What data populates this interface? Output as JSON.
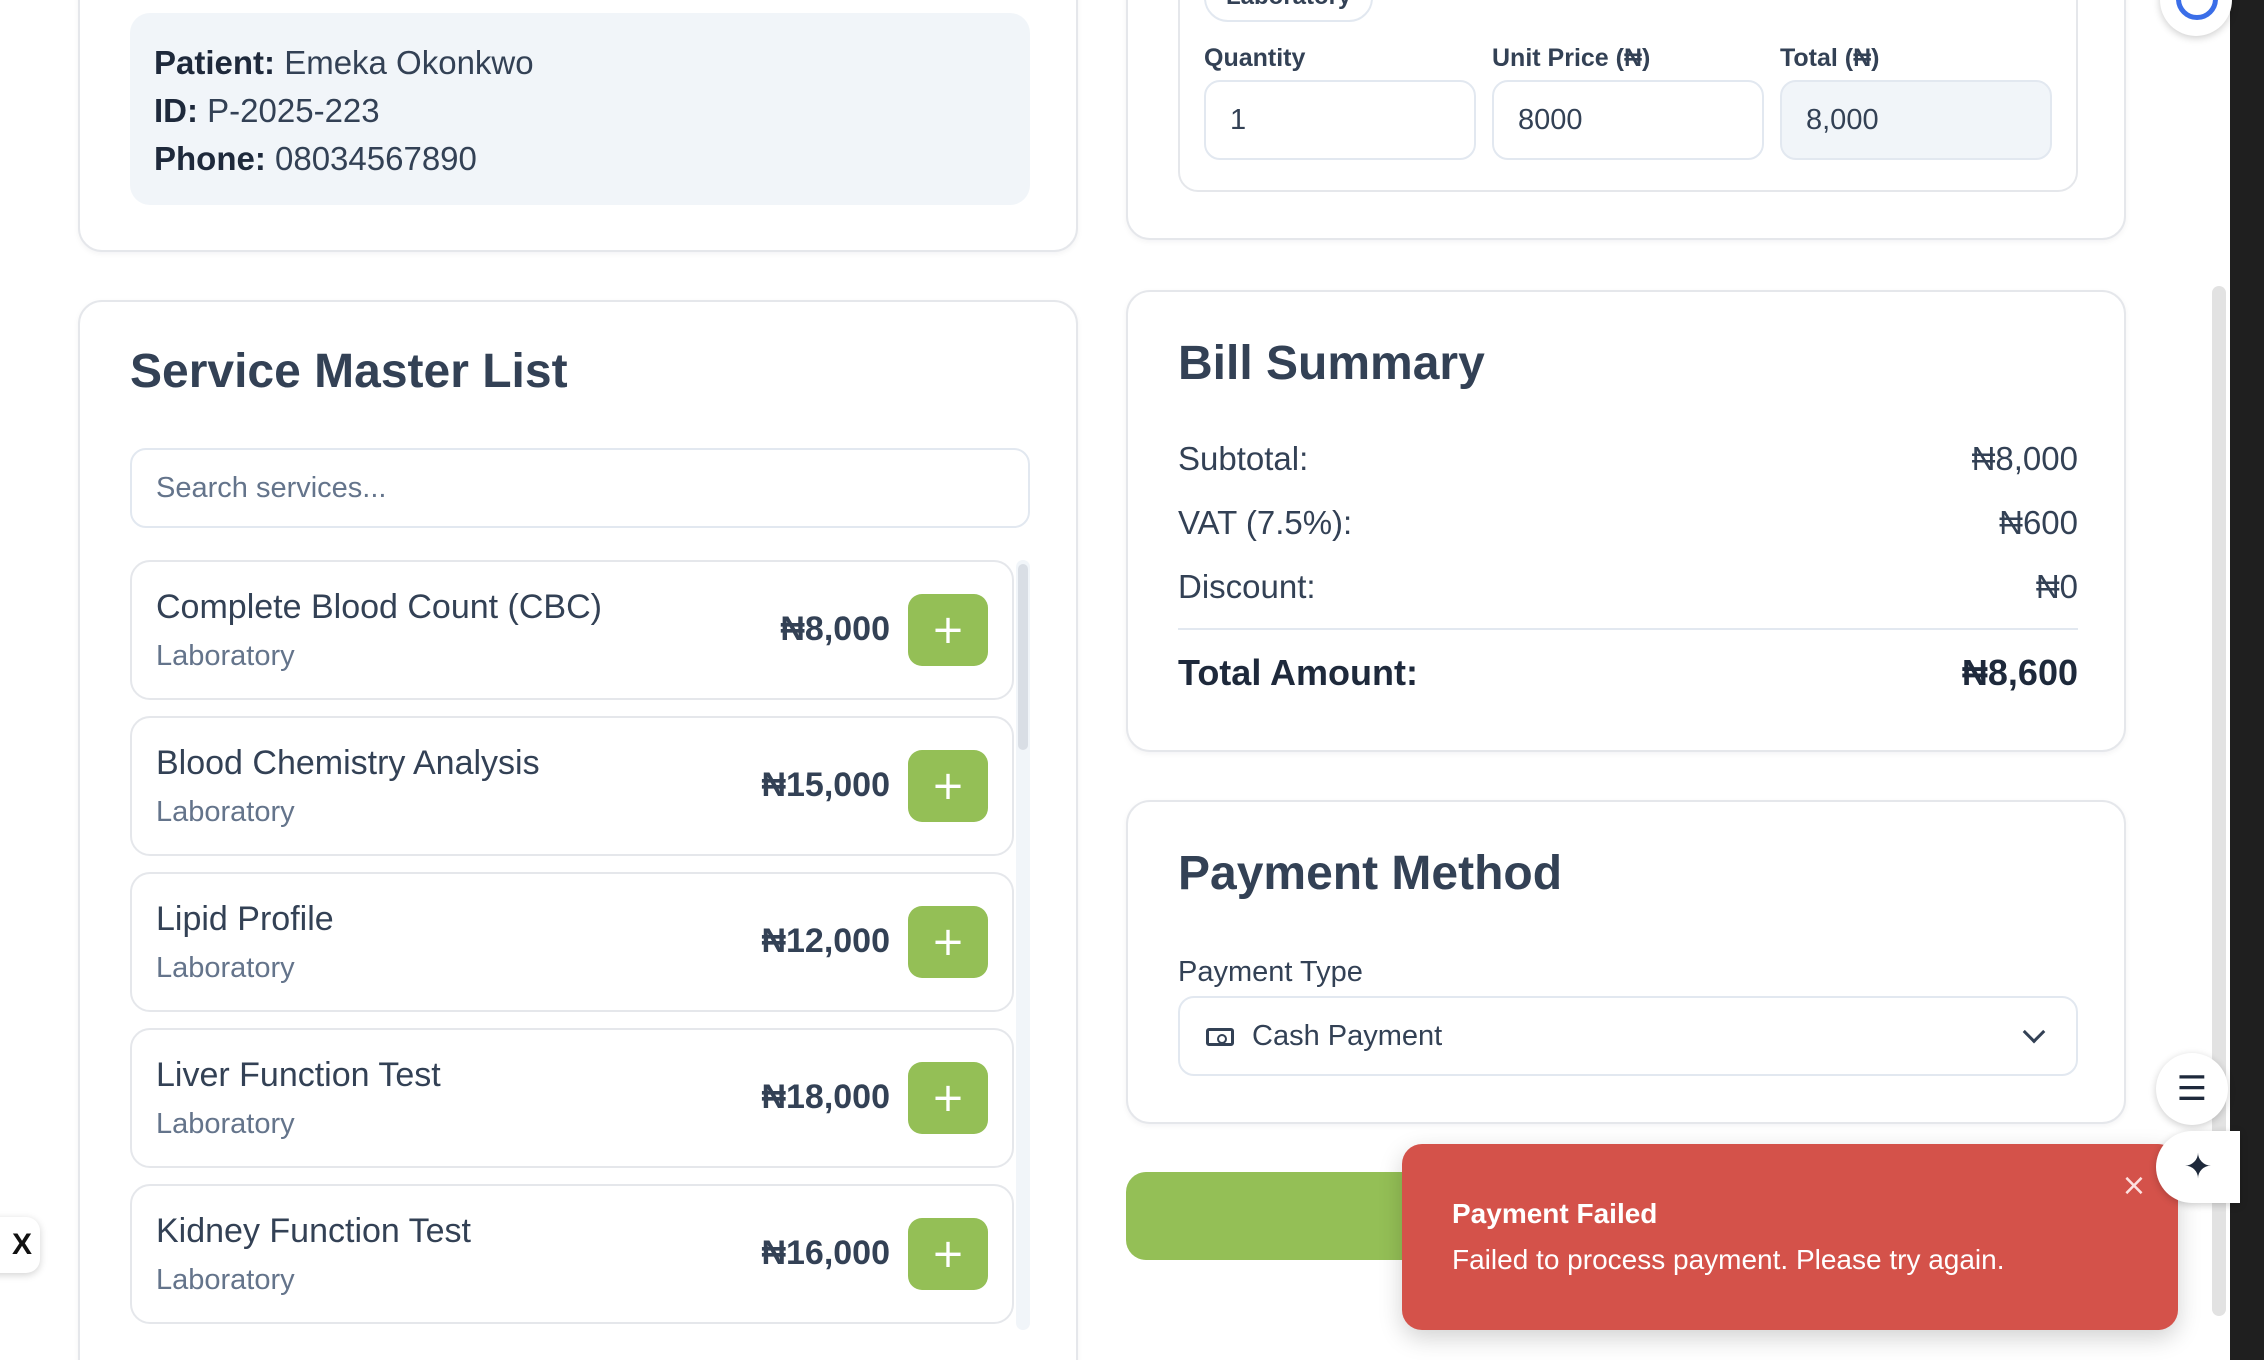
{
  "patient": {
    "name_label": "Patient:",
    "name": "Emeka Okonkwo",
    "id_label": "ID:",
    "id": "P-2025-223",
    "phone_label": "Phone:",
    "phone": "08034567890"
  },
  "service_list": {
    "title": "Service Master List",
    "search_placeholder": "Search services...",
    "items": [
      {
        "name": "Complete Blood Count (CBC)",
        "category": "Laboratory",
        "price": "₦8,000"
      },
      {
        "name": "Blood Chemistry Analysis",
        "category": "Laboratory",
        "price": "₦15,000"
      },
      {
        "name": "Lipid Profile",
        "category": "Laboratory",
        "price": "₦12,000"
      },
      {
        "name": "Liver Function Test",
        "category": "Laboratory",
        "price": "₦18,000"
      },
      {
        "name": "Kidney Function Test",
        "category": "Laboratory",
        "price": "₦16,000"
      }
    ],
    "add_label": "+"
  },
  "selected_item": {
    "category_badge": "Laboratory",
    "quantity_label": "Quantity",
    "quantity": "1",
    "unit_price_label": "Unit Price (₦)",
    "unit_price": "8000",
    "total_label": "Total (₦)",
    "total": "8,000"
  },
  "bill_summary": {
    "title": "Bill Summary",
    "subtotal_label": "Subtotal:",
    "subtotal": "₦8,000",
    "vat_label": "VAT (7.5%):",
    "vat": "₦600",
    "discount_label": "Discount:",
    "discount": "₦0",
    "total_label": "Total Amount:",
    "total": "₦8,600"
  },
  "payment": {
    "title": "Payment Method",
    "type_label": "Payment Type",
    "type_value": "Cash Payment"
  },
  "toast": {
    "title": "Payment Failed",
    "message": "Failed to process payment. Please try again.",
    "close": "×"
  },
  "floating": {
    "list_icon": "☰",
    "spark_icon": "✦",
    "x_label": "X"
  },
  "colors": {
    "accent_green": "#94bf56",
    "error_red": "#d4524a",
    "panel_gray": "#f1f5f9"
  }
}
